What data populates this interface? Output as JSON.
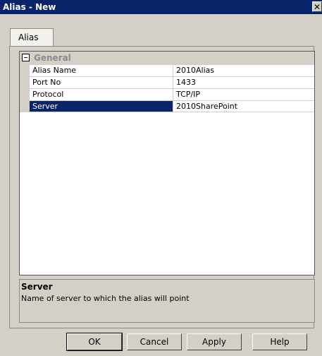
{
  "window": {
    "title": "Alias - New",
    "close_glyph": "✕"
  },
  "tabs": [
    {
      "label": "Alias"
    }
  ],
  "property_grid": {
    "category": "General",
    "rows": [
      {
        "name": "Alias Name",
        "value": "2010Alias"
      },
      {
        "name": "Port No",
        "value": "1433"
      },
      {
        "name": "Protocol",
        "value": "TCP/IP"
      },
      {
        "name": "Server",
        "value": "2010SharePoint",
        "selected": true
      }
    ]
  },
  "description": {
    "title": "Server",
    "text": "Name of server to which the alias will point"
  },
  "buttons": {
    "ok": "OK",
    "cancel": "Cancel",
    "apply": "Apply",
    "help": "Help"
  },
  "colors": {
    "title_bar": "#0a246a",
    "selection": "#0a246a",
    "dialog_bg": "#d4d0c8"
  }
}
